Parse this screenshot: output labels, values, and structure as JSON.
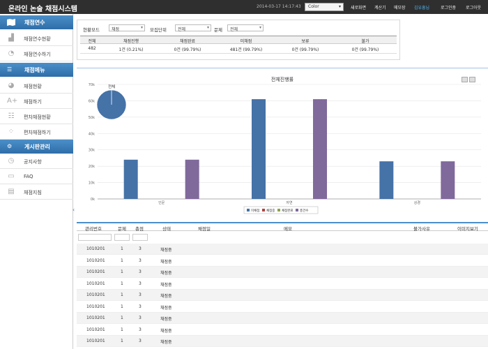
{
  "header": {
    "title": "온라인 논술 채점시스템",
    "datetime": "2014-03-17 14:17:43",
    "color_select": "Color",
    "nav": [
      "새로화면",
      "계산기",
      "메모장"
    ],
    "user_name": "김유흥님",
    "login_status": "로그인중",
    "logout": "로그아웃"
  },
  "sidebar": {
    "sections": [
      {
        "label": "채점연수",
        "icon": "map-icon",
        "items": [
          {
            "label": "채점연수현황",
            "icon": "bar-chart-icon"
          },
          {
            "label": "채점연수하기",
            "icon": "gauge-icon"
          }
        ]
      },
      {
        "label": "채점메뉴",
        "icon": "list-icon",
        "items": [
          {
            "label": "채점현황",
            "icon": "pie-chart-icon"
          },
          {
            "label": "채점하기",
            "icon": "a-plus-icon"
          },
          {
            "label": "편차채점현황",
            "icon": "bullet-list-icon"
          },
          {
            "label": "편차채점하기",
            "icon": "scatter-icon"
          }
        ]
      },
      {
        "label": "게시판관리",
        "icon": "gear-icon",
        "items": [
          {
            "label": "공지사항",
            "icon": "clock-icon"
          },
          {
            "label": "FAQ",
            "icon": "chat-icon"
          },
          {
            "label": "채점지침",
            "icon": "document-icon"
          }
        ]
      }
    ]
  },
  "filters": {
    "mode_label": "현황모드",
    "mode_value": "채점",
    "unit_label": "모집단위",
    "unit_value": "전체",
    "question_label": "문제",
    "question_value": "전체"
  },
  "stats": {
    "headers": [
      "전체",
      "채점진행",
      "채점완료",
      "미채점",
      "보류",
      "불가"
    ],
    "values": [
      "482",
      "1건 (0.21%)",
      "0건 (99.79%)",
      "481건 (99.79%)",
      "0건 (99.79%)",
      "0건 (99.79%)"
    ]
  },
  "chart_data": {
    "type": "bar",
    "title": "전체진행률",
    "categories": [
      "인문",
      "자연",
      "상경"
    ],
    "series": [
      {
        "name": "미채점",
        "color": "#4572a7",
        "values": [
          24,
          61,
          23
        ]
      },
      {
        "name": "채점중",
        "color": "#aa4643",
        "values": [
          0,
          0,
          0
        ]
      },
      {
        "name": "채점완료",
        "color": "#89a54e",
        "values": [
          0,
          0,
          0
        ]
      },
      {
        "name": "총건수",
        "color": "#80699b",
        "values": [
          24,
          61,
          23
        ]
      }
    ],
    "y_ticks": [
      "0k",
      "10k",
      "20k",
      "30k",
      "40k",
      "50k",
      "60k",
      "70k"
    ],
    "ylim": [
      0,
      70
    ],
    "pie": {
      "label": "전체",
      "values": [
        481,
        1
      ]
    },
    "legend": "bottom-center"
  },
  "grid": {
    "headers": [
      "관리번호",
      "문제",
      "총점",
      "상태",
      "채점일",
      "메모",
      "불가사유",
      "이미지보기"
    ],
    "rows": [
      [
        "1010201",
        "1",
        "3",
        "채점중"
      ],
      [
        "1010201",
        "1",
        "3",
        "채점중"
      ],
      [
        "1010201",
        "1",
        "3",
        "채점중"
      ],
      [
        "1010201",
        "1",
        "3",
        "채점중"
      ],
      [
        "1010201",
        "1",
        "3",
        "채점중"
      ],
      [
        "1010201",
        "1",
        "3",
        "채점중"
      ],
      [
        "1010201",
        "1",
        "3",
        "채점중"
      ],
      [
        "1010201",
        "1",
        "3",
        "채점중"
      ],
      [
        "1010201",
        "1",
        "3",
        "채점중"
      ]
    ]
  }
}
